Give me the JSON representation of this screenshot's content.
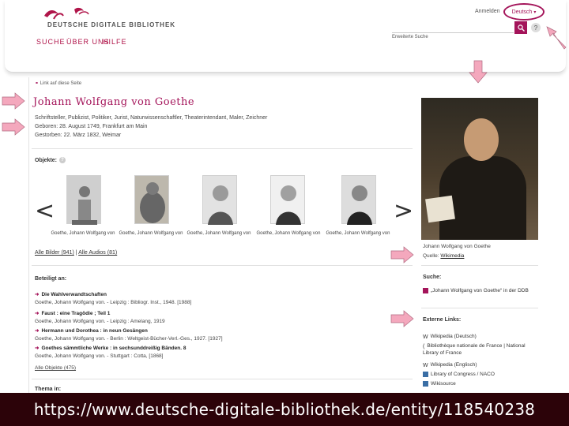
{
  "header": {
    "logo_text": "DEUTSCHE DIGITALE BIBLIOTHEK",
    "nav": [
      "SUCHE",
      "ÜBER UNS",
      "HILFE"
    ],
    "login": "Anmelden",
    "language": "Deutsch",
    "advanced_search": "Erweiterte Suche",
    "search_icon": "search-icon",
    "help_label": "?"
  },
  "entity": {
    "link_label": "Link auf diese Seite",
    "name": "Johann Wolfgang von Goethe",
    "professions": "Schriftsteller, Publizist, Politiker, Jurist, Naturwissenschaftler, Theaterintendant, Maler, Zeichner",
    "born": "Geboren: 28. August 1749, Frankfurt am Main",
    "died": "Gestorben: 22. März 1832, Weimar"
  },
  "objects": {
    "heading": "Objekte:",
    "captions": [
      "Goethe, Johann Wolfgang von",
      "Goethe, Johann Wolfgang von",
      "Goethe, Johann Wolfgang von",
      "Goethe, Johann Wolfgang von",
      "Goethe, Johann Wolfgang von"
    ],
    "all_images": "Alle Bilder (941)",
    "separator": "|",
    "all_audios": "Alle Audios (81)",
    "prev": "<",
    "next": ">"
  },
  "involved": {
    "heading": "Beteiligt an:",
    "items": [
      {
        "title": "Die Wahlverwandtschaften",
        "detail": "Goethe, Johann Wolfgang von. - Leipzig : Bibliogr. Inst., 1948. [1988]"
      },
      {
        "title": "Faust : eine Tragödie ; Teil 1",
        "detail": "Goethe, Johann Wolfgang von. - Leipzig : Amelang, 1919"
      },
      {
        "title": "Hermann und Dorothea : in neun Gesängen",
        "detail": "Goethe, Johann Wolfgang von. - Berlin : Weltgeist-Bücher-Verl.-Ges., 1927. [1927]"
      },
      {
        "title": "Goethes sämmtliche Werke : in sechsunddreißig Bänden. 8",
        "detail": "Goethe, Johann Wolfgang von. - Stuttgart : Cotta, [1868]"
      }
    ],
    "all_objects": "Alle Objekte (475)",
    "next_heading": "Thema in:"
  },
  "portrait": {
    "caption": "Johann Wolfgang von Goethe",
    "source_label": "Quelle:",
    "source_link": "Wikimedia"
  },
  "sidebar": {
    "search_heading": "Suche:",
    "search_item": "„Johann Wolfgang von Goethe“ in der DDB",
    "external_heading": "Externe Links:",
    "links": [
      "Wikipedia (Deutsch)",
      "Bibliothèque nationale de France | National Library of France",
      "Wikipedia (Englisch)",
      "Library of Congress / NACO",
      "Wikisource"
    ]
  },
  "footer": {
    "url": "https://www.deutsche-digitale-bibliothek.de/entity/118540238"
  },
  "colors": {
    "accent": "#a4145a",
    "annotation_arrow": "#f4a8bd",
    "url_bar": "#2c0309"
  }
}
